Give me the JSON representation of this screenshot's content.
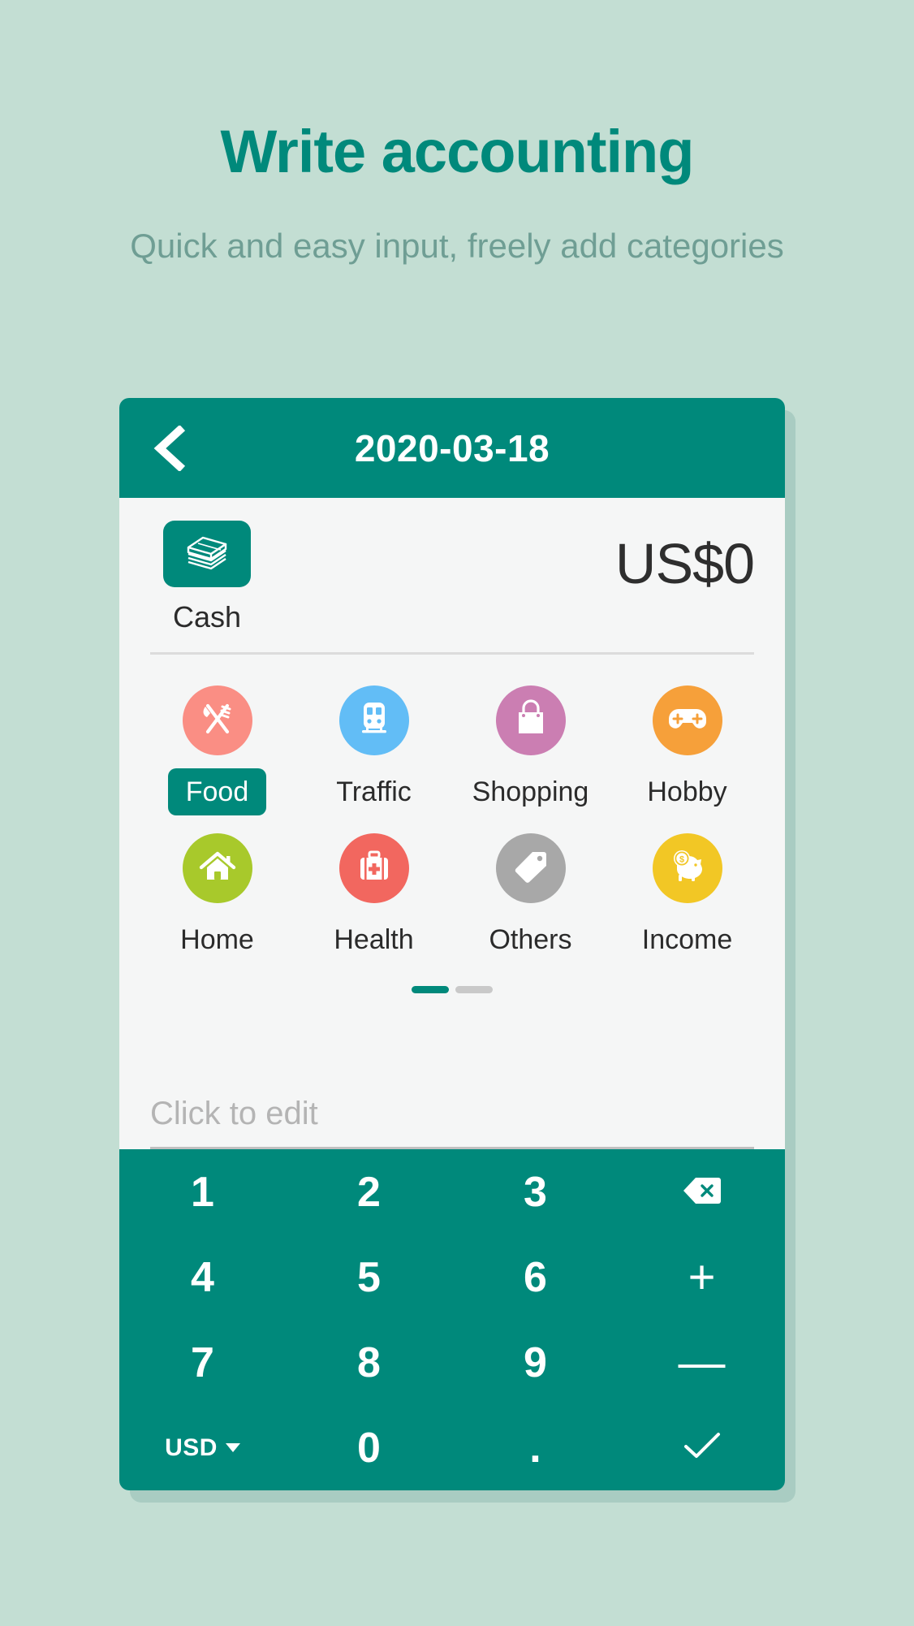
{
  "promo": {
    "headline": "Write accounting",
    "subhead": "Quick and easy input, freely add categories",
    "headline_color": "#00897b",
    "subhead_color": "#6f9e94",
    "background_color": "#c3ded3"
  },
  "titlebar": {
    "back_icon": "chevron-left-icon",
    "date": "2020-03-18",
    "background_color": "#00897b"
  },
  "account": {
    "icon": "cash-stack-icon",
    "label": "Cash",
    "amount": "US$0"
  },
  "categories": {
    "items": [
      {
        "label": "Food",
        "icon": "fork-knife-icon",
        "color": "#fa8e84",
        "selected": true
      },
      {
        "label": "Traffic",
        "icon": "train-icon",
        "color": "#62bdf6",
        "selected": false
      },
      {
        "label": "Shopping",
        "icon": "shopping-bag-icon",
        "color": "#cb7eb2",
        "selected": false
      },
      {
        "label": "Hobby",
        "icon": "gamepad-icon",
        "color": "#f6a03a",
        "selected": false
      },
      {
        "label": "Home",
        "icon": "house-icon",
        "color": "#a8c92b",
        "selected": false
      },
      {
        "label": "Health",
        "icon": "first-aid-kit-icon",
        "color": "#f2675f",
        "selected": false
      },
      {
        "label": "Others",
        "icon": "price-tag-icon",
        "color": "#a8a8a8",
        "selected": false
      },
      {
        "label": "Income",
        "icon": "piggy-bank-icon",
        "color": "#f2c725",
        "selected": false
      }
    ],
    "selected_pill_color": "#00897b"
  },
  "pager": {
    "total": 2,
    "active_index": 0,
    "active_color": "#00897b",
    "inactive_color": "#c9c9c9"
  },
  "note": {
    "value": "",
    "placeholder": "Click to edit"
  },
  "keypad": {
    "background_color": "#00897b",
    "keys": [
      {
        "label": "1",
        "name": "key-1",
        "type": "digit"
      },
      {
        "label": "2",
        "name": "key-2",
        "type": "digit"
      },
      {
        "label": "3",
        "name": "key-3",
        "type": "digit"
      },
      {
        "label": "",
        "name": "key-backspace",
        "type": "icon",
        "icon": "backspace-icon"
      },
      {
        "label": "4",
        "name": "key-4",
        "type": "digit"
      },
      {
        "label": "5",
        "name": "key-5",
        "type": "digit"
      },
      {
        "label": "6",
        "name": "key-6",
        "type": "digit"
      },
      {
        "label": "+",
        "name": "key-plus",
        "type": "symbol"
      },
      {
        "label": "7",
        "name": "key-7",
        "type": "digit"
      },
      {
        "label": "8",
        "name": "key-8",
        "type": "digit"
      },
      {
        "label": "9",
        "name": "key-9",
        "type": "digit"
      },
      {
        "label": "—",
        "name": "key-minus",
        "type": "symbol"
      },
      {
        "label": "USD",
        "name": "key-currency",
        "type": "currency"
      },
      {
        "label": "0",
        "name": "key-0",
        "type": "digit"
      },
      {
        "label": ".",
        "name": "key-decimal",
        "type": "digit"
      },
      {
        "label": "",
        "name": "key-confirm",
        "type": "icon",
        "icon": "checkmark-icon"
      }
    ],
    "currency": "USD"
  }
}
